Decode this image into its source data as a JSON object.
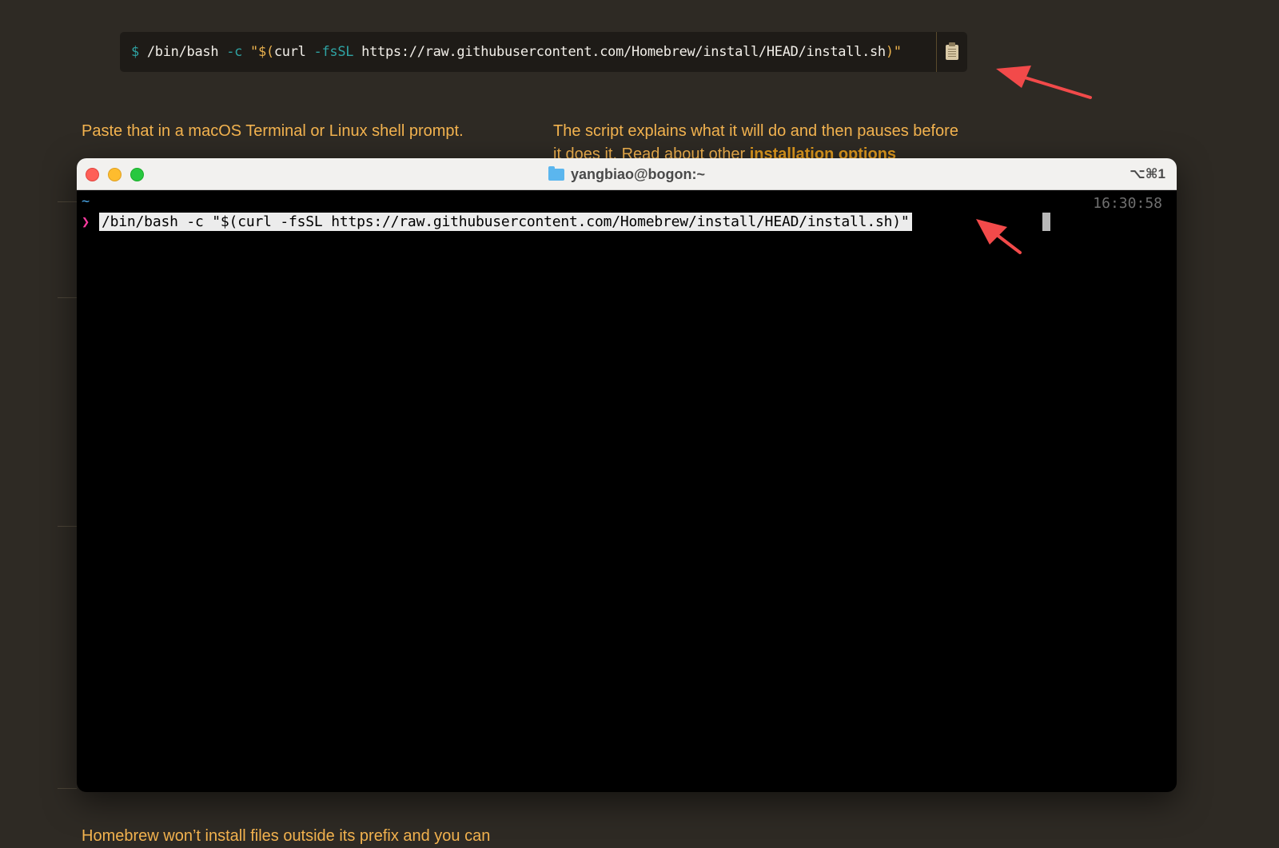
{
  "install_block": {
    "dollar": "$",
    "cmd": " /bin/bash ",
    "flag_c": "-c",
    "str_open": " \"$(",
    "curl": "curl ",
    "flag_fssl": "-fsSL",
    "url": " https://raw.githubusercontent.com/Homebrew/install/HEAD/install.sh",
    "str_close": ")\""
  },
  "copy_button_icon": "clipboard-icon",
  "paragraphs": {
    "paste_instruction": "Paste that in a macOS Terminal or Linux shell prompt.",
    "script_line1": "The script explains what it will do and then pauses before",
    "script_line2_text": "it does it. Read about other ",
    "script_link": "installation options",
    "bottom_text": "Homebrew won’t install files outside its prefix and you can"
  },
  "terminal": {
    "title": "yangbiao@bogon:~",
    "shortcut": "⌥⌘1",
    "tilde": "~",
    "time": "16:30:58",
    "prompt_symbol": "❯",
    "command": "/bin/bash -c \"$(curl -fsSL https://raw.githubusercontent.com/Homebrew/install/HEAD/install.sh)\""
  },
  "colors": {
    "annotation_arrow": "#f24a4a",
    "text_accent": "#f3b34f"
  }
}
